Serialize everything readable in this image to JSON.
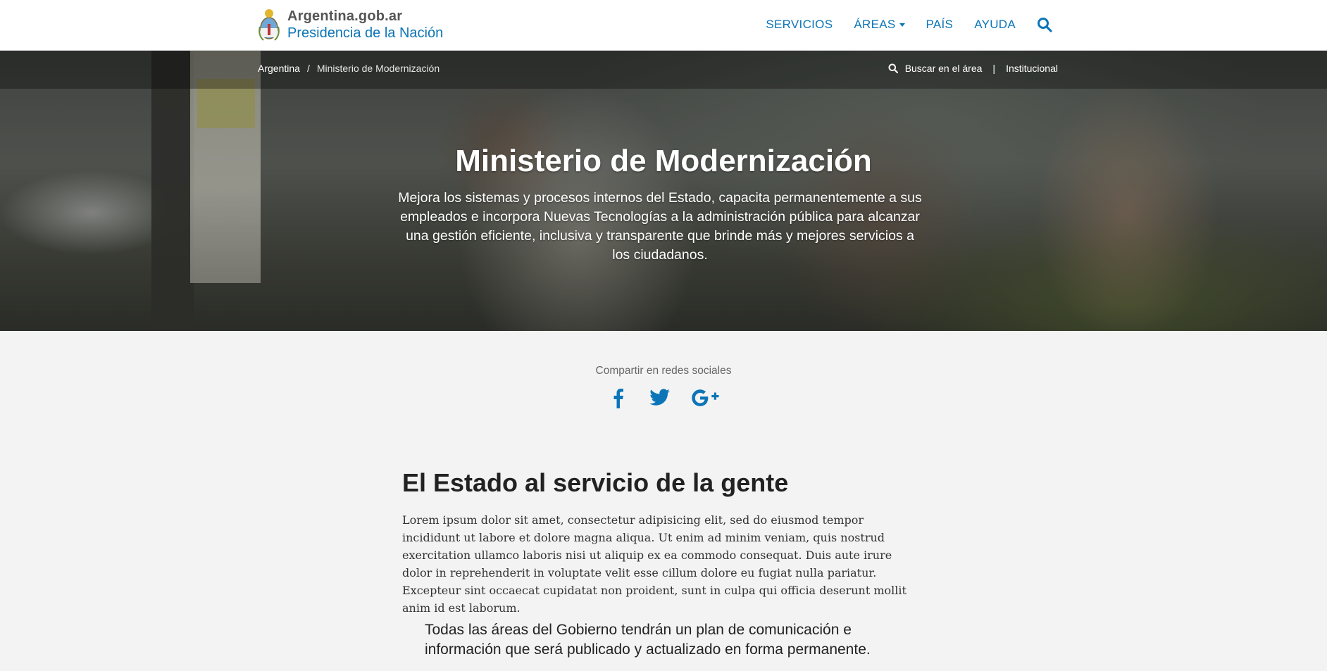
{
  "navbar": {
    "brand_line1": "Argentina.gob.ar",
    "brand_line2": "Presidencia de la Nación",
    "items": [
      "SERVICIOS",
      "ÁREAS",
      "PAÍS",
      "AYUDA"
    ],
    "search_icon": "search-icon",
    "accent_color": "#0c75b8"
  },
  "hero": {
    "breadcrumb": {
      "root": "Argentina",
      "separator": "/",
      "current": "Ministerio de Modernización"
    },
    "search_area": "Buscar en el área",
    "divider": "|",
    "institutional": "Institucional",
    "title": "Ministerio de Modernización",
    "lead": "Mejora los sistemas y procesos internos del Estado, capacita permanentemente a sus empleados e incorpora Nuevas Tecnologías a la administración pública para alcanzar una gestión eficiente, inclusiva y transparente que brinde más y mejores servicios a los ciudadanos."
  },
  "share": {
    "title": "Compartir en redes sociales",
    "icons": [
      "facebook-icon",
      "twitter-icon",
      "google-plus-icon"
    ]
  },
  "content": {
    "heading": "El Estado al servicio de la gente",
    "paragraph": "Lorem ipsum dolor sit amet, consectetur adipisicing elit, sed do eiusmod tempor incididunt ut labore et dolore magna aliqua. Ut enim ad minim veniam, quis nostrud exercitation ullamco laboris nisi ut aliquip ex ea commodo consequat. Duis aute irure dolor in reprehenderit in voluptate velit esse cillum dolore eu fugiat nulla pariatur. Excepteur sint occaecat cupidatat non proident, sunt in culpa qui officia deserunt mollit anim id est laborum.",
    "quote": "Todas las áreas del Gobierno tendrán un plan de comunicación e información que será publicado y actualizado en forma permanente."
  }
}
